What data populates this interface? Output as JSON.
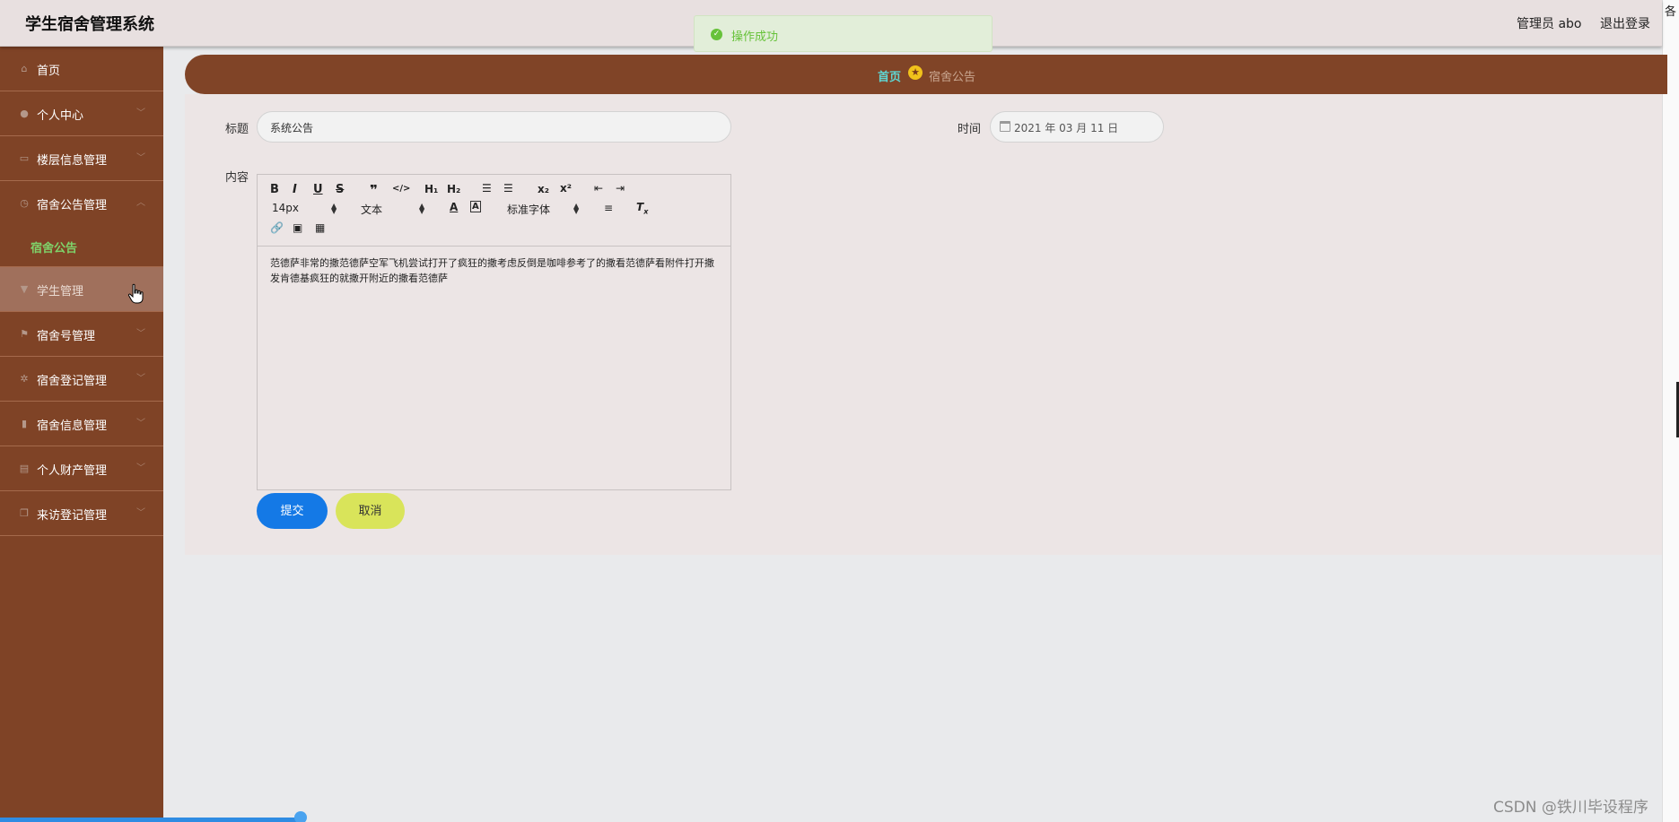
{
  "header": {
    "title": "学生宿舍管理系统",
    "user": "管理员 abo",
    "logout": "退出登录"
  },
  "edge_text": "各",
  "toast": {
    "message": "操作成功"
  },
  "sidebar": {
    "items": [
      {
        "label": "首页",
        "icon": "home-icon",
        "has_arrow": false
      },
      {
        "label": "个人中心",
        "icon": "user-icon",
        "has_arrow": true
      },
      {
        "label": "楼层信息管理",
        "icon": "chat-icon",
        "has_arrow": true
      },
      {
        "label": "宿舍公告管理",
        "icon": "clock-icon",
        "has_arrow": true
      },
      {
        "label": "学生管理",
        "icon": "trophy-icon",
        "has_arrow": false
      },
      {
        "label": "宿舍号管理",
        "icon": "flag-icon",
        "has_arrow": true
      },
      {
        "label": "宿舍登记管理",
        "icon": "gear-icon",
        "has_arrow": true
      },
      {
        "label": "宿舍信息管理",
        "icon": "chart-icon",
        "has_arrow": true
      },
      {
        "label": "个人财产管理",
        "icon": "clipboard-icon",
        "has_arrow": true
      },
      {
        "label": "来访登记管理",
        "icon": "copy-icon",
        "has_arrow": true
      }
    ],
    "submenu": {
      "label": "宿舍公告"
    }
  },
  "breadcrumb": {
    "home": "首页",
    "current": "宿舍公告"
  },
  "form": {
    "title_label": "标题",
    "title_value": "系统公告",
    "time_label": "时间",
    "time_value": "2021 年 03 月 11 日",
    "content_label": "内容",
    "content_value": "范德萨非常的撒范德萨空军飞机尝试打开了疯狂的撒考虑反倒是咖啡参考了的撒看范德萨看附件打开撒发肯德基疯狂的就撒开附近的撒看范德萨",
    "submit_label": "提交",
    "cancel_label": "取消"
  },
  "editor_toolbar": {
    "font_size": "14px",
    "paragraph": "文本",
    "font_family": "标准字体"
  },
  "watermark": "CSDN @铁川毕设程序",
  "colors": {
    "sidebar": "#7f4326",
    "breadcrumb": "#804427",
    "submit": "#1479e6",
    "cancel": "#d9e45a",
    "toast_text": "#67c23a"
  }
}
